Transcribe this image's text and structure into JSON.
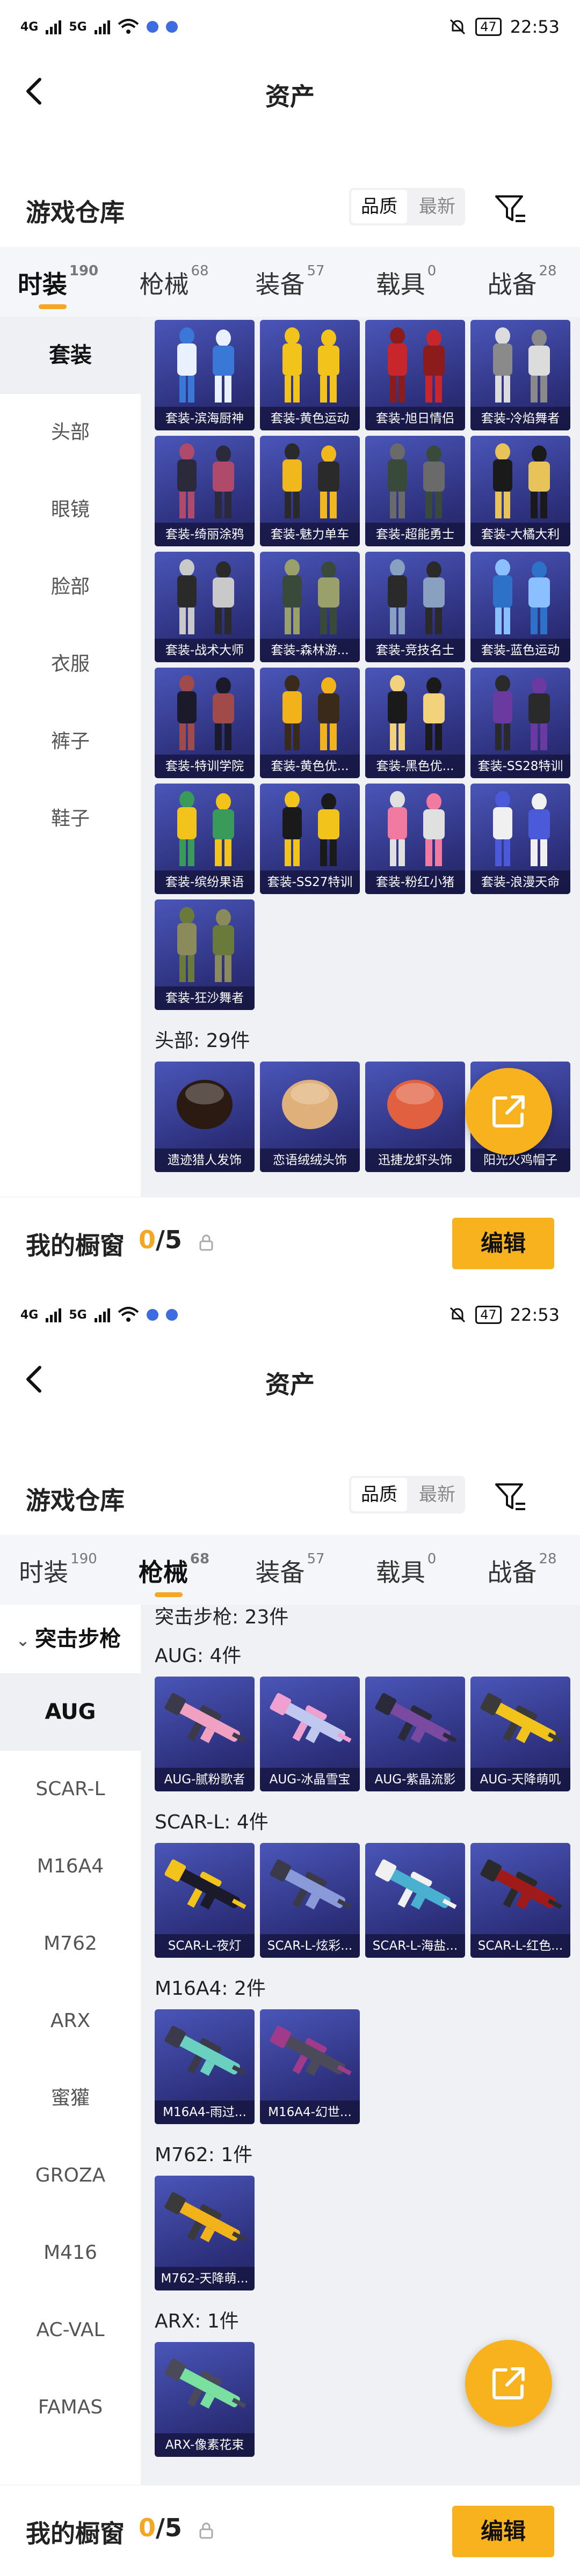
{
  "status": {
    "time": "22:53",
    "battery": "47",
    "signal1": "4G",
    "signal2": "5G"
  },
  "header": {
    "title": "资产"
  },
  "warehouse": {
    "title": "游戏仓库",
    "sort": [
      "品质",
      "最新"
    ]
  },
  "tabs": [
    {
      "label": "时装",
      "count": "190"
    },
    {
      "label": "枪械",
      "count": "68"
    },
    {
      "label": "装备",
      "count": "57"
    },
    {
      "label": "载具",
      "count": "0"
    },
    {
      "label": "战备",
      "count": "28"
    }
  ],
  "screen1": {
    "active_tab": 0,
    "sidebar": [
      "套装",
      "头部",
      "眼镜",
      "脸部",
      "衣服",
      "裤子",
      "鞋子"
    ],
    "outfits": [
      "套装-滨海厨神",
      "套装-黄色运动",
      "套装-旭日情侣",
      "套装-冷焰舞者",
      "套装-绮丽涂鸦",
      "套装-魅力单车",
      "套装-超能勇士",
      "套装-大橘大利",
      "套装-战术大师",
      "套装-森林游...",
      "套装-竞技名士",
      "套装-蓝色运动",
      "套装-特训学院",
      "套装-黄色优...",
      "套装-黑色优...",
      "套装-SS28特训",
      "套装-缤纷果语",
      "套装-SS27特训",
      "套装-粉红小猪",
      "套装-浪漫天命",
      "套装-狂沙舞者"
    ],
    "head_label": "头部: 29件",
    "heads": [
      "遗迹猎人发饰",
      "恋语绒绒头饰",
      "迅捷龙虾头饰",
      "阳光火鸡帽子"
    ]
  },
  "screen2": {
    "active_tab": 1,
    "group": "突击步枪",
    "sidebar": [
      "AUG",
      "SCAR-L",
      "M16A4",
      "M762",
      "ARX",
      "蜜獾",
      "GROZA",
      "M416",
      "AC-VAL",
      "FAMAS"
    ],
    "top_label": "突击步枪: 23件",
    "sections": [
      {
        "label": "AUG: 4件",
        "items": [
          "AUG-腻粉歌者",
          "AUG-冰晶雪宝",
          "AUG-紫晶流影",
          "AUG-天降萌叽"
        ]
      },
      {
        "label": "SCAR-L: 4件",
        "items": [
          "SCAR-L-夜灯",
          "SCAR-L-炫彩...",
          "SCAR-L-海盐...",
          "SCAR-L-红色..."
        ]
      },
      {
        "label": "M16A4: 2件",
        "items": [
          "M16A4-雨过...",
          "M16A4-幻世..."
        ]
      },
      {
        "label": "M762: 1件",
        "items": [
          "M762-天降萌..."
        ]
      },
      {
        "label": "ARX: 1件",
        "items": [
          "ARX-像素花束"
        ]
      }
    ]
  },
  "bottom": {
    "title": "我的橱窗",
    "used": "0",
    "total": "/5",
    "edit": "编辑"
  },
  "colors": {
    "accent": "#f7b21e",
    "card_bg": "#3a3f9a",
    "tabbar_bg": "#f4f6fa"
  },
  "icons": [
    "back-arrow-icon",
    "filter-icon",
    "share-out-icon",
    "lock-icon",
    "chevron-down-icon"
  ]
}
